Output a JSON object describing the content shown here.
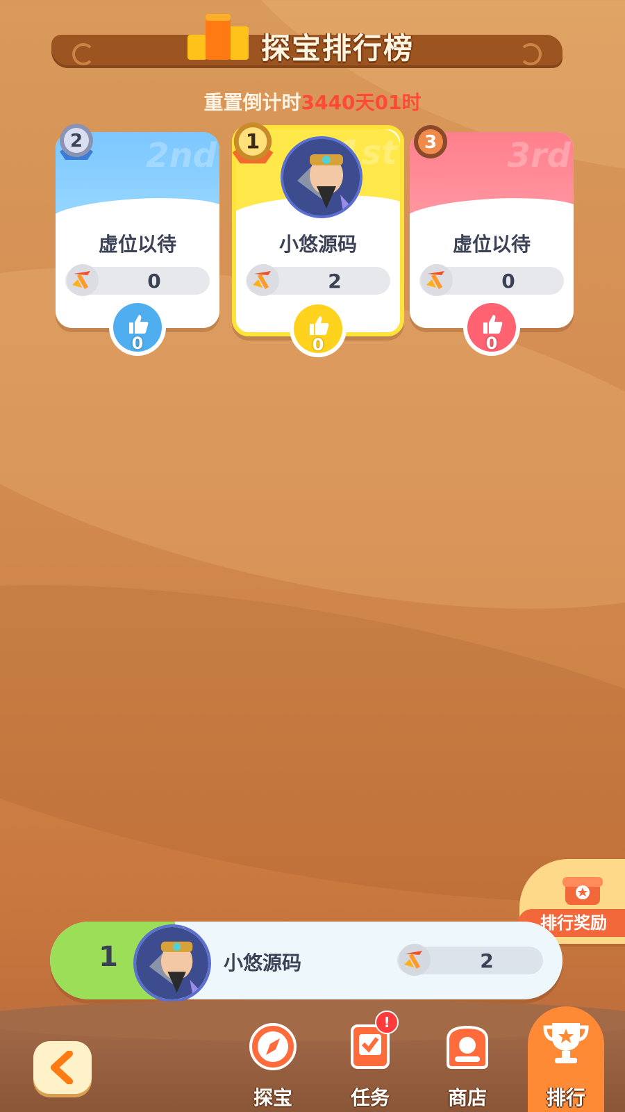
{
  "header": {
    "title": "探宝排行榜",
    "countdown_label": "重置倒计时",
    "countdown_value": "3440天01时"
  },
  "podium": [
    {
      "rank": 2,
      "name": "虚位以待",
      "score": "0",
      "likes": "0",
      "watermark": "2nd",
      "color": "#4eaef0"
    },
    {
      "rank": 1,
      "name": "小悠源码",
      "score": "2",
      "likes": "0",
      "watermark": "1st",
      "color": "#ffd21e"
    },
    {
      "rank": 3,
      "name": "虚位以待",
      "score": "0",
      "likes": "0",
      "watermark": "3rd",
      "color": "#ff6270"
    }
  ],
  "my_rank": {
    "rank": "1",
    "name": "小悠源码",
    "score": "2"
  },
  "reward": {
    "label": "排行奖励"
  },
  "nav": {
    "items": [
      {
        "label": "探宝",
        "icon": "compass-icon"
      },
      {
        "label": "任务",
        "icon": "task-icon",
        "alert": "!"
      },
      {
        "label": "商店",
        "icon": "shop-icon"
      },
      {
        "label": "排行",
        "icon": "trophy-icon",
        "active": true
      }
    ]
  }
}
